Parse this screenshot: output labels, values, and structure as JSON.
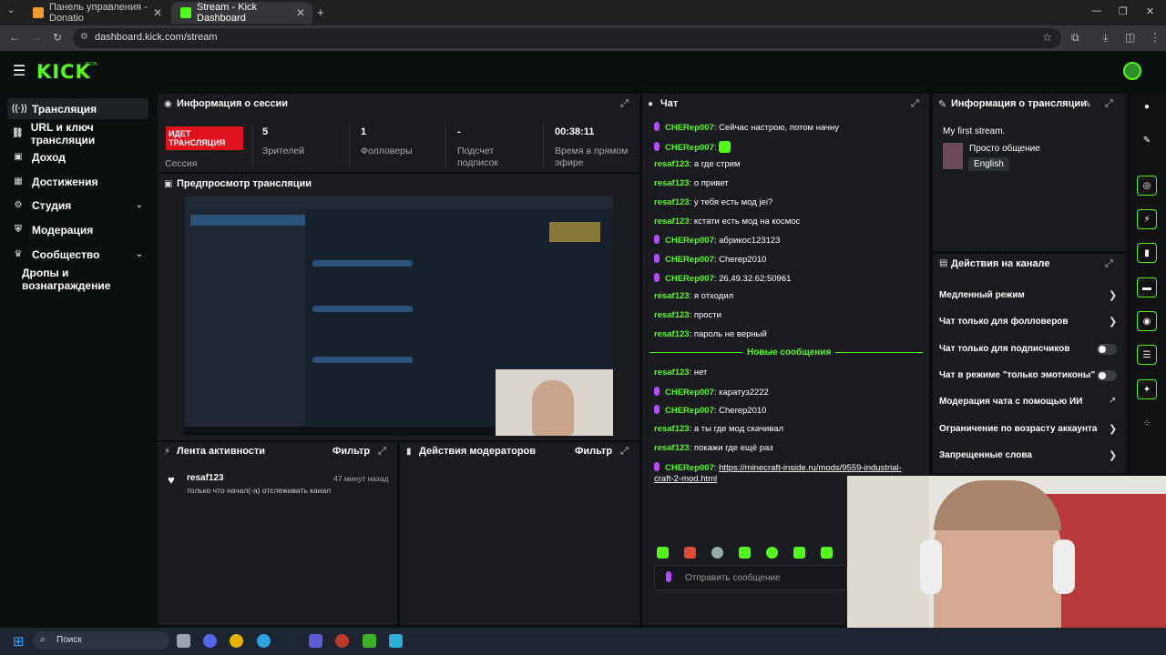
{
  "browser": {
    "tabs": [
      {
        "title": "Панель управления - Donatio",
        "active": false
      },
      {
        "title": "Stream - Kick Dashboard",
        "active": true
      }
    ],
    "url": "dashboard.kick.com/stream"
  },
  "header": {
    "logo": "KICK",
    "beta": "BETA"
  },
  "sidebar": {
    "items": [
      {
        "label": "Трансляция",
        "icon": "broadcast-icon",
        "active": true
      },
      {
        "label": "URL и ключ трансляции",
        "icon": "link-icon"
      },
      {
        "label": "Доход",
        "icon": "dollar-icon"
      },
      {
        "label": "Достижения",
        "icon": "trophy-icon"
      },
      {
        "label": "Студия",
        "icon": "studio-icon",
        "chevron": true
      },
      {
        "label": "Модерация",
        "icon": "shield-icon"
      },
      {
        "label": "Сообщество",
        "icon": "community-icon",
        "chevron": true
      },
      {
        "label": "Дропы и вознаграждение",
        "icon": ""
      }
    ]
  },
  "session": {
    "title": "Информация о сессии",
    "live_badge": "ИДЕТ ТРАНСЛЯЦИЯ",
    "session_label": "Сессия",
    "stats": [
      {
        "value": "5",
        "label": "Зрителей"
      },
      {
        "value": "1",
        "label": "Фолловеры"
      },
      {
        "value": "-",
        "label": "Подсчет подписок"
      },
      {
        "value": "00:38:11",
        "label": "Время в прямом эфире"
      }
    ]
  },
  "preview": {
    "title": "Предпросмотр трансляции"
  },
  "activity": {
    "title": "Лента активности",
    "filter": "Фильтр",
    "items": [
      {
        "user": "resaf123",
        "time": "47 минут назад",
        "text": "только что начал(-а) отслеживать канал"
      }
    ]
  },
  "mod_actions": {
    "title": "Действия модераторов",
    "filter": "Фильтр"
  },
  "chat": {
    "title": "Чат",
    "messages": [
      {
        "user": "CHERep007",
        "text": "Сейчас настрою, потом начну",
        "mod": true
      },
      {
        "user": "CHERep007",
        "text": "",
        "mod": true,
        "emote": true
      },
      {
        "user": "resaf123",
        "text": "а где стрим",
        "mod": false
      },
      {
        "user": "resaf123",
        "text": "о привет",
        "mod": false
      },
      {
        "user": "resaf123",
        "text": "у тебя есть мод jei?",
        "mod": false
      },
      {
        "user": "resaf123",
        "text": "кстати есть мод на космос",
        "mod": false
      },
      {
        "user": "CHERep007",
        "text": "абрикос123123",
        "mod": true
      },
      {
        "user": "CHERep007",
        "text": "Cherep2010",
        "mod": true
      },
      {
        "user": "CHERep007",
        "text": "26.49.32.62:50961",
        "mod": true
      },
      {
        "user": "resaf123",
        "text": "я отходил",
        "mod": false
      },
      {
        "user": "resaf123",
        "text": "прости",
        "mod": false
      },
      {
        "user": "resaf123",
        "text": "пароль не верный",
        "mod": false
      }
    ],
    "new_messages_label": "Новые сообщения",
    "new_messages": [
      {
        "user": "resaf123",
        "text": "нет",
        "mod": false
      },
      {
        "user": "CHERep007",
        "text": "каратуз2222",
        "mod": true
      },
      {
        "user": "CHERep007",
        "text": "Cherep2010",
        "mod": true
      },
      {
        "user": "resaf123",
        "text": "а ты где мод скачивал",
        "mod": false
      },
      {
        "user": "resaf123",
        "text": "покажи где ещё раз",
        "mod": false
      },
      {
        "user": "CHERep007",
        "text": "https://minecraft-inside.ru/mods/9559-industrial-",
        "text2": "craft-2-mod.html",
        "mod": true,
        "link": true
      }
    ],
    "input_placeholder": "Отправить сообщение"
  },
  "stream_info": {
    "title": "Информация о трансляции",
    "stream_title": "My first stream.",
    "category": "Просто общение",
    "language": "English"
  },
  "channel_actions": {
    "title": "Действия на канале",
    "items": [
      {
        "label": "Медленный режим",
        "type": "chevron"
      },
      {
        "label": "Чат только для фолловеров",
        "type": "chevron"
      },
      {
        "label": "Чат только для подписчиков",
        "type": "toggle"
      },
      {
        "label": "Чат в режиме \"только эмотиконы\"",
        "type": "toggle"
      },
      {
        "label": "Модерация чата с помощью ИИ",
        "type": "external"
      },
      {
        "label": "Ограничение по возрасту аккаунта",
        "type": "chevron"
      },
      {
        "label": "Запрещенные слова",
        "type": "chevron"
      }
    ]
  },
  "taskbar": {
    "search": "Поиск"
  },
  "colors": {
    "brand": "#53fc18",
    "live": "#e0101c",
    "panel": "#191b1f",
    "background": "#0b0e0f",
    "mod_badge": "#b44cff"
  }
}
